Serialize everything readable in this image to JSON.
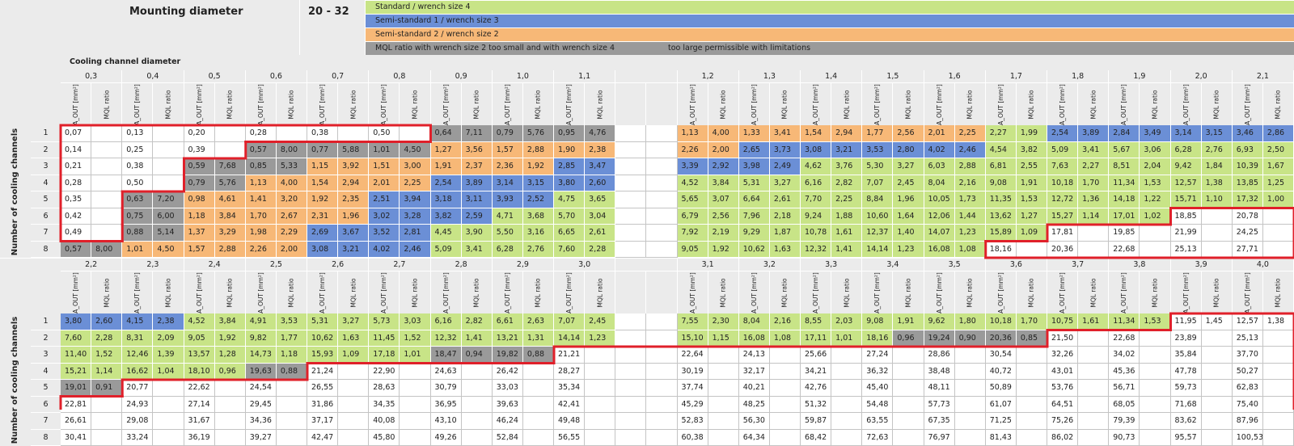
{
  "header": {
    "mounting_label": "Mounting diameter",
    "range_label": "20 - 32",
    "cooling_label": "Cooling channel diameter",
    "count_label": "Number of cooling channels",
    "legend": [
      {
        "text": "Standard / wrench size 4",
        "color": "#c8e487"
      },
      {
        "text": "Semi-standard 1 / wrench size 3",
        "color": "#6b8fd6"
      },
      {
        "text": "Semi-standard 2 / wrench size 2",
        "color": "#f7b877"
      },
      {
        "text": "MQL ratio with wrench size 2 too small and with wrench size 4",
        "color": "#9a9a9a"
      }
    ],
    "legend_note": "too large permissible with limitations",
    "col_label_a": "A_OUT [mm²]",
    "col_label_b": "MQL ratio"
  },
  "colors": {
    "G": "#c8e487",
    "B": "#6b8fd6",
    "O": "#f7b877",
    "D": "#9a9a9a",
    "W": "#ffffff",
    "outline": "#e0202a"
  },
  "top": {
    "diameters": [
      "0,3",
      "0,4",
      "0,5",
      "0,6",
      "0,7",
      "0,8",
      "0,9",
      "1,0",
      "1,1",
      "",
      "1,2",
      "1,3",
      "1,4",
      "1,5",
      "1,6",
      "1,7",
      "1,8",
      "1,9",
      "2,0",
      "2,1"
    ],
    "rows": [
      {
        "n": "1",
        "cells": [
          "0,07",
          "",
          "0,13",
          "",
          "0,20",
          "",
          "0,28",
          "",
          "0,38",
          "",
          "0,50",
          "",
          "0,64",
          "7,11",
          "0,79",
          "5,76",
          "0,95",
          "4,76",
          "",
          "",
          "1,13",
          "4,00",
          "1,33",
          "3,41",
          "1,54",
          "2,94",
          "1,77",
          "2,56",
          "2,01",
          "2,25",
          "2,27",
          "1,99",
          "2,54",
          "3,89",
          "2,84",
          "3,49",
          "3,14",
          "3,15",
          "3,46",
          "2,86"
        ],
        "colors": "WWWWWWWWWWWWDDDDDDWWOOOOOOOOOOGGBBBBBBBB"
      },
      {
        "n": "2",
        "cells": [
          "0,14",
          "",
          "0,25",
          "",
          "0,39",
          "",
          "0,57",
          "8,00",
          "0,77",
          "5,88",
          "1,01",
          "4,50",
          "1,27",
          "3,56",
          "1,57",
          "2,88",
          "1,90",
          "2,38",
          "",
          "",
          "2,26",
          "2,00",
          "2,65",
          "3,73",
          "3,08",
          "3,21",
          "3,53",
          "2,80",
          "4,02",
          "2,46",
          "4,54",
          "3,82",
          "5,09",
          "3,41",
          "5,67",
          "3,06",
          "6,28",
          "2,76",
          "6,93",
          "2,50"
        ],
        "colors": "WWWWWWDDDDDDOOOOOOWWOOBBBBBBBBGGGGGGGGGG"
      },
      {
        "n": "3",
        "cells": [
          "0,21",
          "",
          "0,38",
          "",
          "0,59",
          "7,68",
          "0,85",
          "5,33",
          "1,15",
          "3,92",
          "1,51",
          "3,00",
          "1,91",
          "2,37",
          "2,36",
          "1,92",
          "2,85",
          "3,47",
          "",
          "",
          "3,39",
          "2,92",
          "3,98",
          "2,49",
          "4,62",
          "3,76",
          "5,30",
          "3,27",
          "6,03",
          "2,88",
          "6,81",
          "2,55",
          "7,63",
          "2,27",
          "8,51",
          "2,04",
          "9,42",
          "1,84",
          "10,39",
          "1,67"
        ],
        "colors": "WWWWDDDDOOOOOOOOBBWWBBBBGGGGGGGGGGGGGGGG"
      },
      {
        "n": "4",
        "cells": [
          "0,28",
          "",
          "0,50",
          "",
          "0,79",
          "5,76",
          "1,13",
          "4,00",
          "1,54",
          "2,94",
          "2,01",
          "2,25",
          "2,54",
          "3,89",
          "3,14",
          "3,15",
          "3,80",
          "2,60",
          "",
          "",
          "4,52",
          "3,84",
          "5,31",
          "3,27",
          "6,16",
          "2,82",
          "7,07",
          "2,45",
          "8,04",
          "2,16",
          "9,08",
          "1,91",
          "10,18",
          "1,70",
          "11,34",
          "1,53",
          "12,57",
          "1,38",
          "13,85",
          "1,25"
        ],
        "colors": "WWWWDDOOOOOOBBBBBBWWGGGGGGGGGGGGGGGGGGGG"
      },
      {
        "n": "5",
        "cells": [
          "0,35",
          "",
          "0,63",
          "7,20",
          "0,98",
          "4,61",
          "1,41",
          "3,20",
          "1,92",
          "2,35",
          "2,51",
          "3,94",
          "3,18",
          "3,11",
          "3,93",
          "2,52",
          "4,75",
          "3,65",
          "",
          "",
          "5,65",
          "3,07",
          "6,64",
          "2,61",
          "7,70",
          "2,25",
          "8,84",
          "1,96",
          "10,05",
          "1,73",
          "11,35",
          "1,53",
          "12,72",
          "1,36",
          "14,18",
          "1,22",
          "15,71",
          "1,10",
          "17,32",
          "1,00"
        ],
        "colors": "WWDDOOOOOOBBBBBBGGWWGGGGGGGGGGGGGGGGGGGG"
      },
      {
        "n": "6",
        "cells": [
          "0,42",
          "",
          "0,75",
          "6,00",
          "1,18",
          "3,84",
          "1,70",
          "2,67",
          "2,31",
          "1,96",
          "3,02",
          "3,28",
          "3,82",
          "2,59",
          "4,71",
          "3,68",
          "5,70",
          "3,04",
          "",
          "",
          "6,79",
          "2,56",
          "7,96",
          "2,18",
          "9,24",
          "1,88",
          "10,60",
          "1,64",
          "12,06",
          "1,44",
          "13,62",
          "1,27",
          "15,27",
          "1,14",
          "17,01",
          "1,02",
          "18,85",
          "",
          "20,78",
          ""
        ],
        "colors": "WWDDOOOOOOBBBBGGGGWWGGGGGGGGGGGGGGGGWWWW"
      },
      {
        "n": "7",
        "cells": [
          "0,49",
          "",
          "0,88",
          "5,14",
          "1,37",
          "3,29",
          "1,98",
          "2,29",
          "2,69",
          "3,67",
          "3,52",
          "2,81",
          "4,45",
          "3,90",
          "5,50",
          "3,16",
          "6,65",
          "2,61",
          "",
          "",
          "7,92",
          "2,19",
          "9,29",
          "1,87",
          "10,78",
          "1,61",
          "12,37",
          "1,40",
          "14,07",
          "1,23",
          "15,89",
          "1,09",
          "17,81",
          "",
          "19,85",
          "",
          "21,99",
          "",
          "24,25",
          ""
        ],
        "colors": "WWDDOOOOBBBBGGGGGGWWGGGGGGGGGGGGWWWWWWWW"
      },
      {
        "n": "8",
        "cells": [
          "0,57",
          "8,00",
          "1,01",
          "4,50",
          "1,57",
          "2,88",
          "2,26",
          "2,00",
          "3,08",
          "3,21",
          "4,02",
          "2,46",
          "5,09",
          "3,41",
          "6,28",
          "2,76",
          "7,60",
          "2,28",
          "",
          "",
          "9,05",
          "1,92",
          "10,62",
          "1,63",
          "12,32",
          "1,41",
          "14,14",
          "1,23",
          "16,08",
          "1,08",
          "18,16",
          "",
          "20,36",
          "",
          "22,68",
          "",
          "25,13",
          "",
          "27,71",
          ""
        ],
        "colors": "DDOOOOOOBBBBGGGGGGWWGGGGGGGGGGWWWWWWWWWW"
      }
    ]
  },
  "bottom": {
    "diameters": [
      "2,2",
      "2,3",
      "2,4",
      "2,5",
      "2,6",
      "2,7",
      "2,8",
      "2,9",
      "3,0",
      "",
      "3,1",
      "3,2",
      "3,3",
      "3,4",
      "3,5",
      "3,6",
      "3,7",
      "3,8",
      "3,9",
      "4,0"
    ],
    "rows": [
      {
        "n": "1",
        "cells": [
          "3,80",
          "2,60",
          "4,15",
          "2,38",
          "4,52",
          "3,84",
          "4,91",
          "3,53",
          "5,31",
          "3,27",
          "5,73",
          "3,03",
          "6,16",
          "2,82",
          "6,61",
          "2,63",
          "7,07",
          "2,45",
          "",
          "",
          "7,55",
          "2,30",
          "8,04",
          "2,16",
          "8,55",
          "2,03",
          "9,08",
          "1,91",
          "9,62",
          "1,80",
          "10,18",
          "1,70",
          "10,75",
          "1,61",
          "11,34",
          "1,53",
          "11,95",
          "1,45",
          "12,57",
          "1,38"
        ],
        "colors": "BBBBGGGGGGGGGGGGGGWWGGGGGGGGGGGGGGGGWWWW"
      },
      {
        "n": "2",
        "cells": [
          "7,60",
          "2,28",
          "8,31",
          "2,09",
          "9,05",
          "1,92",
          "9,82",
          "1,77",
          "10,62",
          "1,63",
          "11,45",
          "1,52",
          "12,32",
          "1,41",
          "13,21",
          "1,31",
          "14,14",
          "1,23",
          "",
          "",
          "15,10",
          "1,15",
          "16,08",
          "1,08",
          "17,11",
          "1,01",
          "18,16",
          "0,96",
          "19,24",
          "0,90",
          "20,36",
          "0,85",
          "21,50",
          "",
          "22,68",
          "",
          "23,89",
          "",
          "25,13",
          ""
        ],
        "colors": "GGGGGGGGGGGGGGGGGGWWGGGGGGGDDDDDWWWWWWWW"
      },
      {
        "n": "3",
        "cells": [
          "11,40",
          "1,52",
          "12,46",
          "1,39",
          "13,57",
          "1,28",
          "14,73",
          "1,18",
          "15,93",
          "1,09",
          "17,18",
          "1,01",
          "18,47",
          "0,94",
          "19,82",
          "0,88",
          "21,21",
          "",
          "",
          "",
          "22,64",
          "",
          "24,13",
          "",
          "25,66",
          "",
          "27,24",
          "",
          "28,86",
          "",
          "30,54",
          "",
          "32,26",
          "",
          "34,02",
          "",
          "35,84",
          "",
          "37,70",
          ""
        ],
        "colors": "GGGGGGGGGGGGDDDDWWWWWWWWWWWWWWWWWWWWWWWW"
      },
      {
        "n": "4",
        "cells": [
          "15,21",
          "1,14",
          "16,62",
          "1,04",
          "18,10",
          "0,96",
          "19,63",
          "0,88",
          "21,24",
          "",
          "22,90",
          "",
          "24,63",
          "",
          "26,42",
          "",
          "28,27",
          "",
          "",
          "",
          "30,19",
          "",
          "32,17",
          "",
          "34,21",
          "",
          "36,32",
          "",
          "38,48",
          "",
          "40,72",
          "",
          "43,01",
          "",
          "45,36",
          "",
          "47,78",
          "",
          "50,27",
          ""
        ],
        "colors": "GGGGGGDDWWWWWWWWWWWWWWWWWWWWWWWWWWWWWWWW"
      },
      {
        "n": "5",
        "cells": [
          "19,01",
          "0,91",
          "20,77",
          "",
          "22,62",
          "",
          "24,54",
          "",
          "26,55",
          "",
          "28,63",
          "",
          "30,79",
          "",
          "33,03",
          "",
          "35,34",
          "",
          "",
          "",
          "37,74",
          "",
          "40,21",
          "",
          "42,76",
          "",
          "45,40",
          "",
          "48,11",
          "",
          "50,89",
          "",
          "53,76",
          "",
          "56,71",
          "",
          "59,73",
          "",
          "62,83",
          ""
        ],
        "colors": "DDWWWWWWWWWWWWWWWWWWWWWWWWWWWWWWWWWWWWWW"
      },
      {
        "n": "6",
        "cells": [
          "22,81",
          "",
          "24,93",
          "",
          "27,14",
          "",
          "29,45",
          "",
          "31,86",
          "",
          "34,35",
          "",
          "36,95",
          "",
          "39,63",
          "",
          "42,41",
          "",
          "",
          "",
          "45,29",
          "",
          "48,25",
          "",
          "51,32",
          "",
          "54,48",
          "",
          "57,73",
          "",
          "61,07",
          "",
          "64,51",
          "",
          "68,05",
          "",
          "71,68",
          "",
          "75,40",
          ""
        ],
        "colors": "WWWWWWWWWWWWWWWWWWWWWWWWWWWWWWWWWWWWWWWW"
      },
      {
        "n": "7",
        "cells": [
          "26,61",
          "",
          "29,08",
          "",
          "31,67",
          "",
          "34,36",
          "",
          "37,17",
          "",
          "40,08",
          "",
          "43,10",
          "",
          "46,24",
          "",
          "49,48",
          "",
          "",
          "",
          "52,83",
          "",
          "56,30",
          "",
          "59,87",
          "",
          "63,55",
          "",
          "67,35",
          "",
          "71,25",
          "",
          "75,26",
          "",
          "79,39",
          "",
          "83,62",
          "",
          "87,96",
          ""
        ],
        "colors": "WWWWWWWWWWWWWWWWWWWWWWWWWWWWWWWWWWWWWWWW"
      },
      {
        "n": "8",
        "cells": [
          "30,41",
          "",
          "33,24",
          "",
          "36,19",
          "",
          "39,27",
          "",
          "42,47",
          "",
          "45,80",
          "",
          "49,26",
          "",
          "52,84",
          "",
          "56,55",
          "",
          "",
          "",
          "60,38",
          "",
          "64,34",
          "",
          "68,42",
          "",
          "72,63",
          "",
          "76,97",
          "",
          "81,43",
          "",
          "86,02",
          "",
          "90,73",
          "",
          "95,57",
          "",
          "100,53",
          ""
        ],
        "colors": "WWWWWWWWWWWWWWWWWWWWWWWWWWWWWWWWWWWWWWWW"
      }
    ]
  }
}
